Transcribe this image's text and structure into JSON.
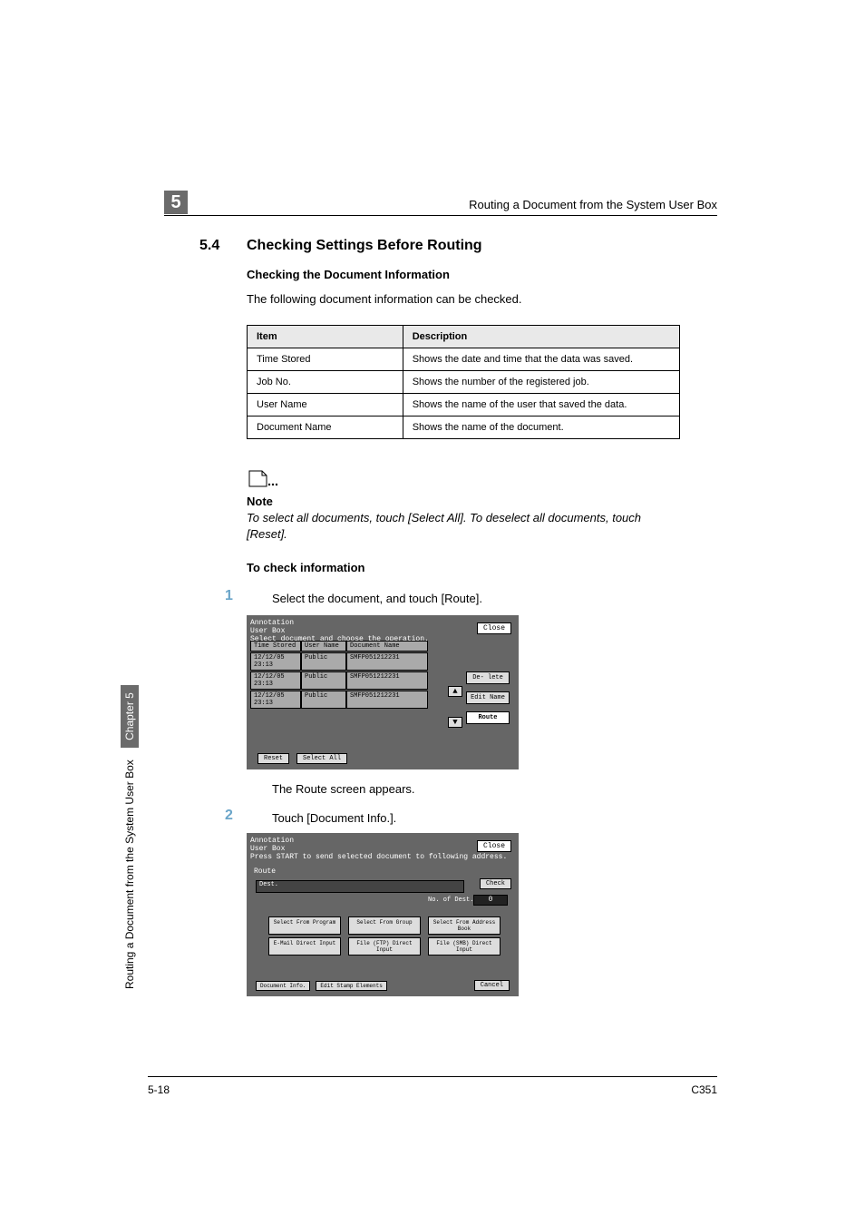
{
  "header": {
    "chapter_badge": "5",
    "running_title": "Routing a Document from the System User Box"
  },
  "section": {
    "number": "5.4",
    "title": "Checking Settings Before Routing"
  },
  "subhead1": "Checking the Document Information",
  "intro": "The following document information can be checked.",
  "table": {
    "col1": "Item",
    "col2": "Description",
    "rows": [
      {
        "item": "Time Stored",
        "desc": "Shows the date and time that the data was saved."
      },
      {
        "item": "Job No.",
        "desc": "Shows the number of the registered job."
      },
      {
        "item": "User Name",
        "desc": "Shows the name of the user that saved the data."
      },
      {
        "item": "Document Name",
        "desc": "Shows the name of the document."
      }
    ]
  },
  "note": {
    "head": "Note",
    "body": "To select all documents, touch [Select All]. To deselect all documents, touch [Reset]."
  },
  "subhead2": "To check information",
  "steps": {
    "s1": {
      "num": "1",
      "text": "Select the document, and touch [Route]."
    },
    "s1_after": "The Route screen appears.",
    "s2": {
      "num": "2",
      "text": "Touch [Document Info.]."
    }
  },
  "screen1": {
    "title_l1": "Annotation",
    "title_l2": "User Box",
    "subtitle": "Select document and choose the operation.",
    "close": "Close",
    "th_time": "Time Stored",
    "th_user": "User Name",
    "th_doc": "Document Name",
    "rows": [
      {
        "time": "12/12/05 23:13",
        "user": "Public",
        "doc": "SMFP051212231"
      },
      {
        "time": "12/12/05 23:13",
        "user": "Public",
        "doc": "SMFP051212231"
      },
      {
        "time": "12/12/05 23:13",
        "user": "Public",
        "doc": "SMFP051212231"
      }
    ],
    "side": {
      "delete": "De- lete",
      "edit": "Edit Name",
      "route": "Route"
    },
    "arrows": {
      "up": "▲",
      "down": "▼"
    },
    "bottom": {
      "reset": "Reset",
      "selectall": "Select All"
    }
  },
  "screen2": {
    "title_l1": "Annotation",
    "title_l2": "User Box",
    "subtitle": "Press START to send selected document to following address.",
    "close": "Close",
    "route_label": "Route",
    "dest_label": "Dest.",
    "check": "Check",
    "count_label": "No. of Dest.",
    "count_val": "0",
    "row1": {
      "a": "Select From Program",
      "b": "Select From Group",
      "c": "Select From Address Book"
    },
    "row2": {
      "a": "E-Mail Direct Input",
      "b": "File (FTP) Direct Input",
      "c": "File (SMB) Direct Input"
    },
    "bottom": {
      "doc": "Document Info.",
      "stamp": "Edit Stamp Elements"
    },
    "cancel": "Cancel"
  },
  "side": {
    "text": "Routing a Document from the System User Box",
    "chap": "Chapter 5"
  },
  "footer": {
    "left": "5-18",
    "right": "C351"
  }
}
